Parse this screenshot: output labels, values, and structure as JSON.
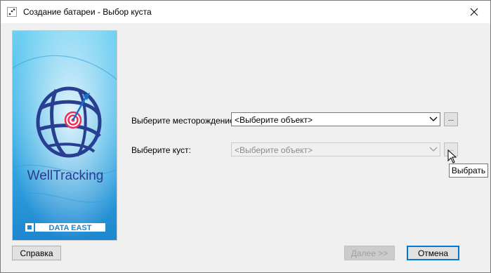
{
  "window": {
    "title": "Создание батареи - Выбор куста",
    "close_label": "×"
  },
  "banner": {
    "brand": "WellTracking",
    "vendor": "DATA EAST",
    "colors": {
      "bg_top": "#5dc7ee",
      "bg_bottom": "#1a86cf",
      "brand_text": "#283f91",
      "ring_red": "#e8325a"
    }
  },
  "form": {
    "deposit": {
      "label": "Выберите месторождение:",
      "value": "<Выберите объект>",
      "enabled": true
    },
    "cluster": {
      "label": "Выберите куст:",
      "value": "<Выберите объект>",
      "enabled": false
    },
    "browse_label": "...",
    "tooltip": "Выбрать"
  },
  "buttons": {
    "help": "Справка",
    "next": "Далее >>",
    "cancel": "Отмена"
  }
}
